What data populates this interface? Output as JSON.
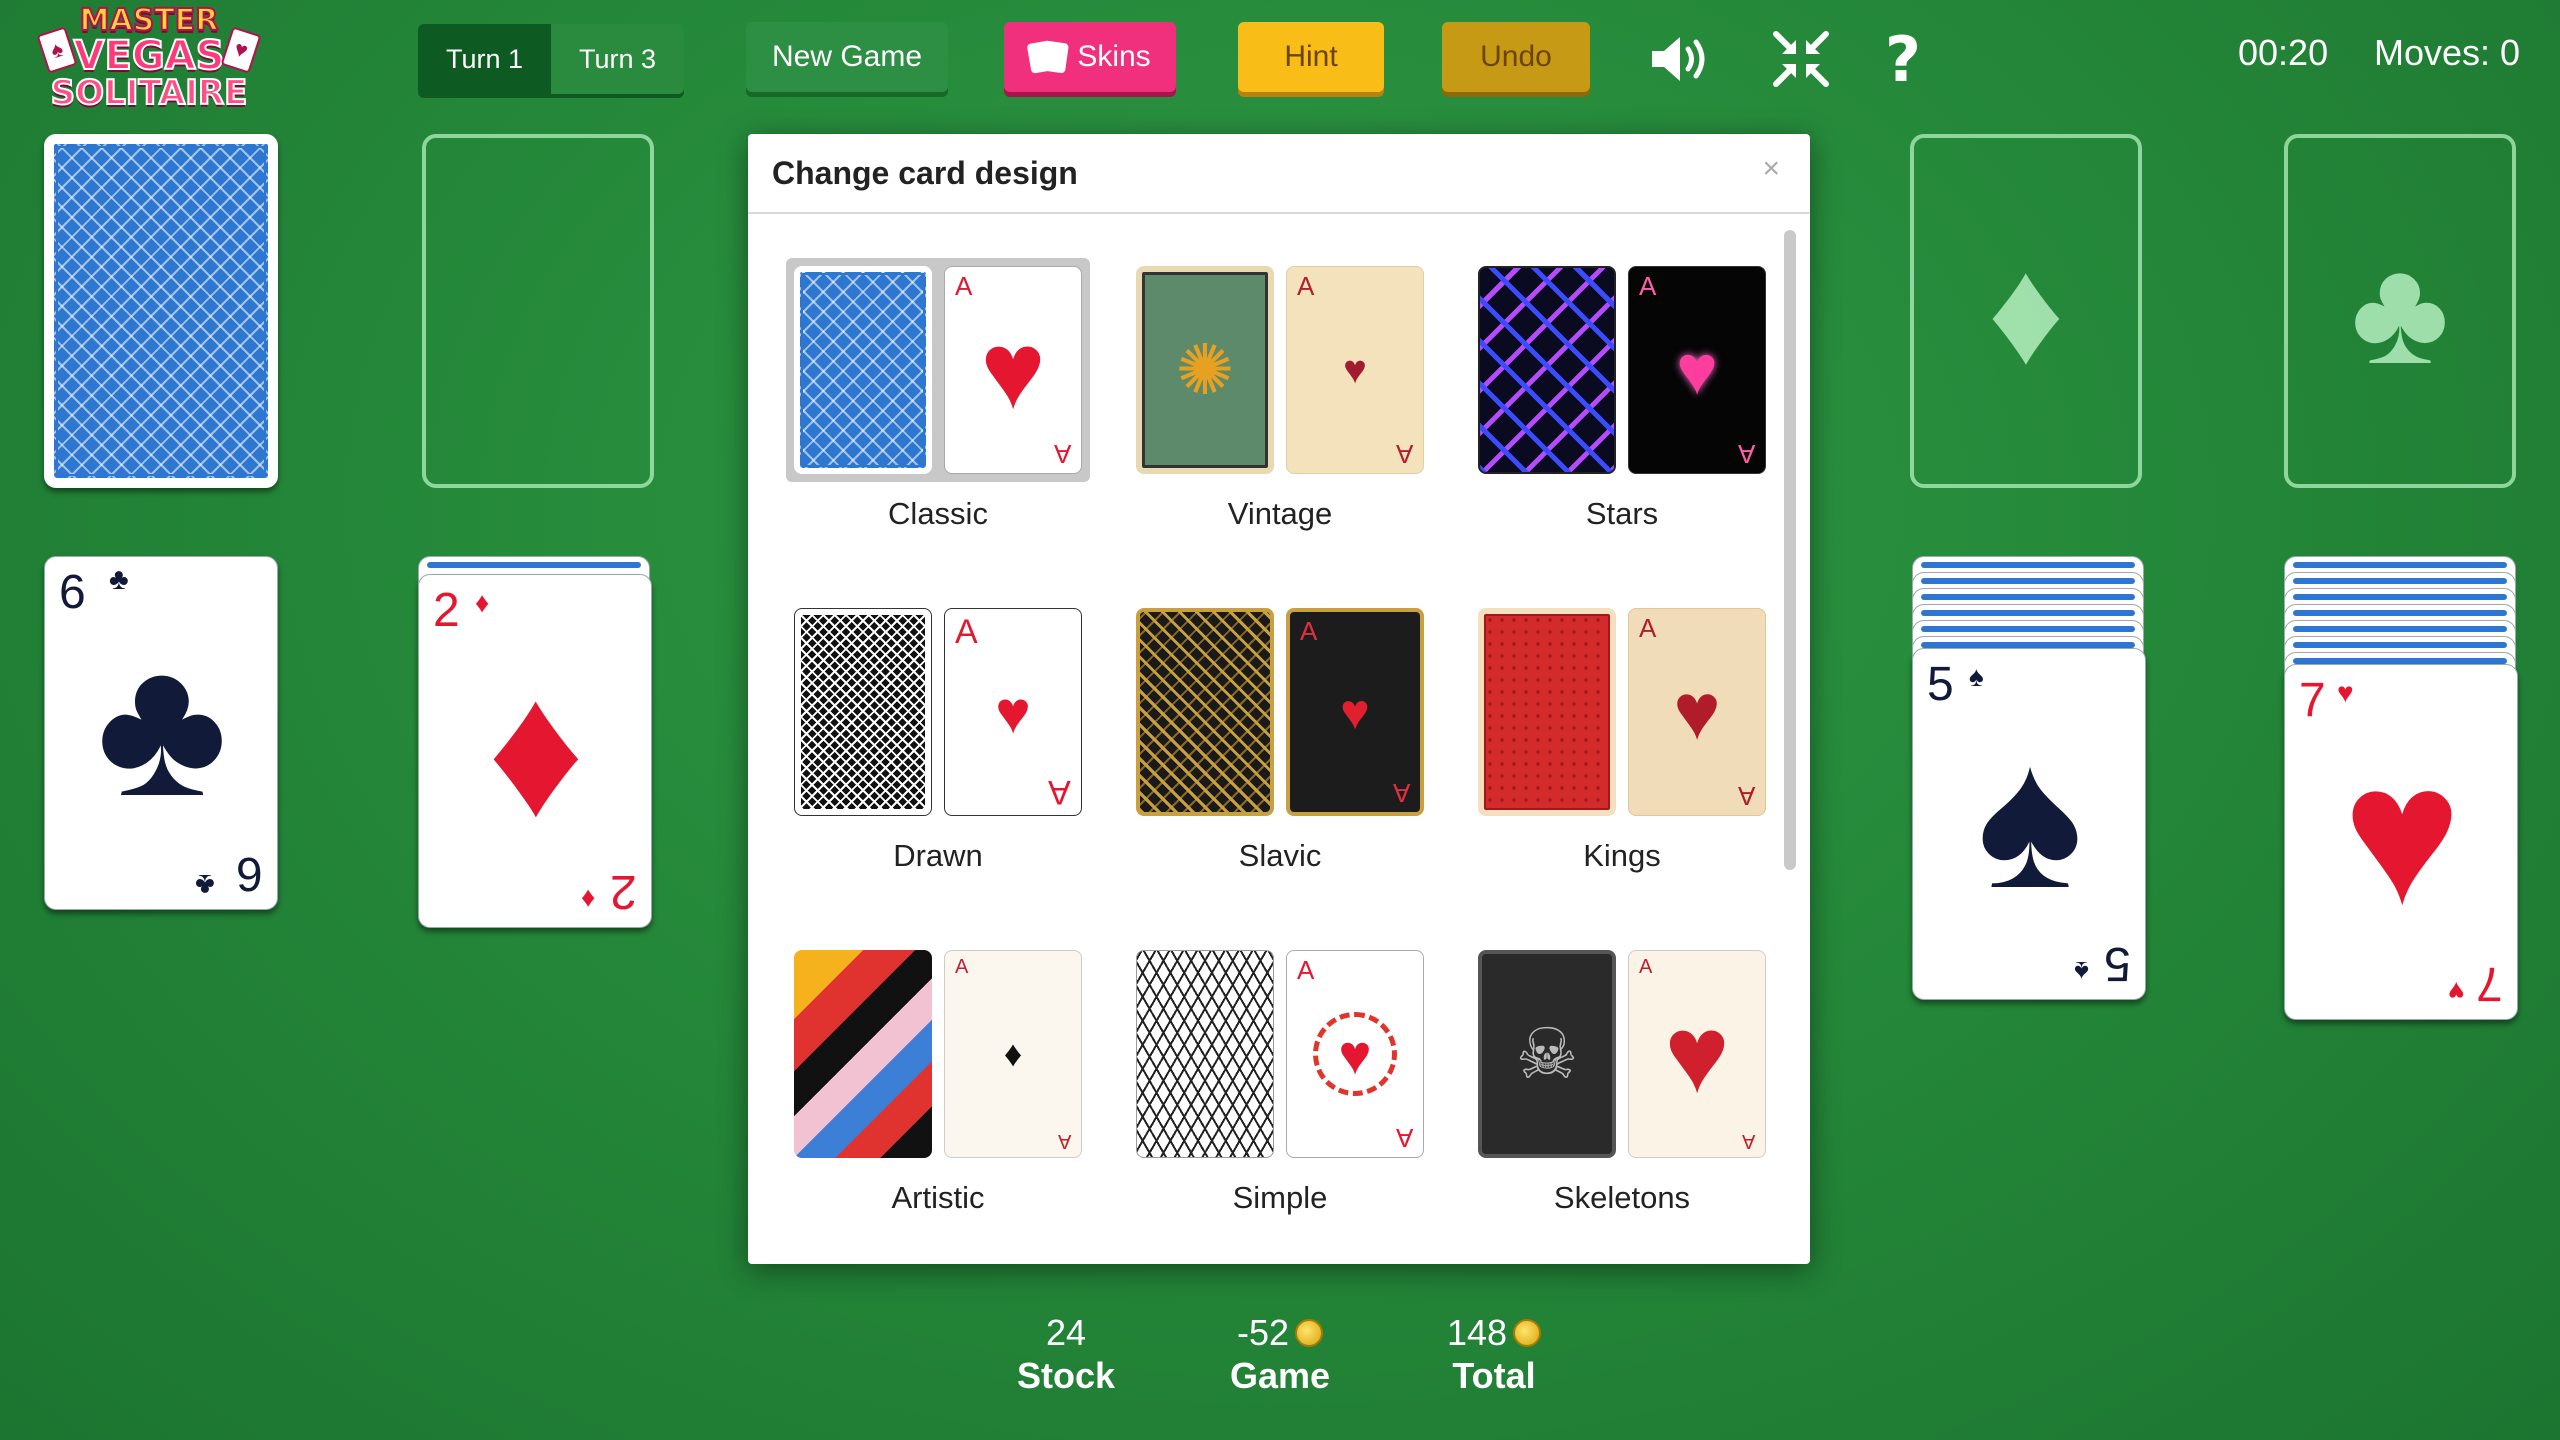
{
  "logo": {
    "line1": "MASTER",
    "line2": "VEGAS",
    "line3": "SOLITAIRE"
  },
  "toolbar": {
    "turn1": "Turn 1",
    "turn3": "Turn 3",
    "new_game": "New Game",
    "skins": "Skins",
    "hint": "Hint",
    "undo": "Undo",
    "icons": [
      "speaker-icon",
      "collapse-icon",
      "help-icon"
    ]
  },
  "status": {
    "timer": "00:20",
    "moves": "Moves: 0"
  },
  "cards": {
    "waste": {
      "rank": "6",
      "suit": "♣"
    },
    "col2": {
      "rank": "2",
      "suit": "♦"
    },
    "col6": {
      "rank": "5",
      "suit": "♠"
    },
    "col7": {
      "rank": "7",
      "suit": "♥"
    },
    "foundation_diamond": "♦",
    "foundation_club": "♣"
  },
  "modal": {
    "title": "Change card design",
    "close": "×",
    "selected": "Classic",
    "skins": [
      {
        "name": "Classic",
        "ace_rank": "A",
        "ace_suit": "♥"
      },
      {
        "name": "Vintage",
        "ace_rank": "A",
        "ace_suit": "♥"
      },
      {
        "name": "Stars",
        "ace_rank": "A",
        "ace_suit": "♥"
      },
      {
        "name": "Drawn",
        "ace_rank": "A",
        "ace_suit": "♥"
      },
      {
        "name": "Slavic",
        "ace_rank": "A",
        "ace_suit": "♥"
      },
      {
        "name": "Kings",
        "ace_rank": "A",
        "ace_suit": "♥"
      },
      {
        "name": "Artistic",
        "ace_rank": "A",
        "ace_suit": "♦"
      },
      {
        "name": "Simple",
        "ace_rank": "A",
        "ace_suit": "♥"
      },
      {
        "name": "Skeletons",
        "ace_rank": "A",
        "ace_suit": "♥"
      }
    ]
  },
  "stats": {
    "stock_value": "24",
    "stock_label": "Stock",
    "game_value": "-52",
    "game_label": "Game",
    "total_value": "148",
    "total_label": "Total"
  },
  "colors": {
    "felt": "#25893a",
    "accent_pink": "#f0307c",
    "hint_yellow": "#f8be17",
    "card_back_blue": "#2e77d0",
    "suit_red": "#e5162f"
  }
}
